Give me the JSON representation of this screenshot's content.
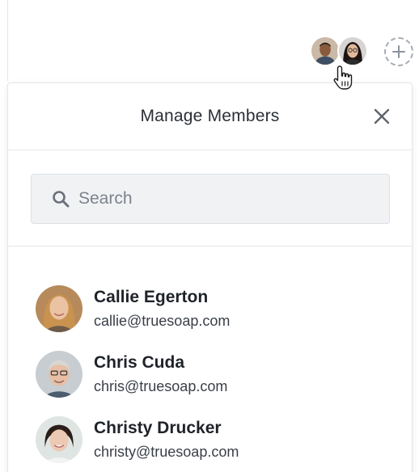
{
  "topbar": {
    "avatars": [
      {
        "icon": "person-avatar",
        "skin": "#8a5a3c",
        "hair": "#2a1d16",
        "bg": "#c9b9a6"
      },
      {
        "icon": "person-avatar",
        "skin": "#e2b899",
        "hair": "#1b1412",
        "bg": "#d8d4d2"
      }
    ],
    "add_icon": "plus-icon",
    "cursor_icon": "hand-pointer-icon"
  },
  "panel": {
    "title": "Manage Members",
    "close_icon": "close-icon"
  },
  "search": {
    "placeholder": "Search",
    "value": "",
    "icon": "search-icon"
  },
  "members": [
    {
      "name": "Callie Egerton",
      "email": "callie@truesoap.com",
      "skin": "#eac3a3",
      "hair": "#c9924f",
      "bg": "#b78a5b"
    },
    {
      "name": "Chris Cuda",
      "email": "chris@truesoap.com",
      "skin": "#e6bfa5",
      "hair": "#d9d6d2",
      "bg": "#c7cdd1"
    },
    {
      "name": "Christy Drucker",
      "email": "christy@truesoap.com",
      "skin": "#ecc9b2",
      "hair": "#2b1e18",
      "bg": "#dfe5e3"
    }
  ],
  "colors": {
    "border": "#e4e6ea",
    "search_bg": "#f1f2f4",
    "text": "#1f2329",
    "muted": "#7d838c"
  }
}
